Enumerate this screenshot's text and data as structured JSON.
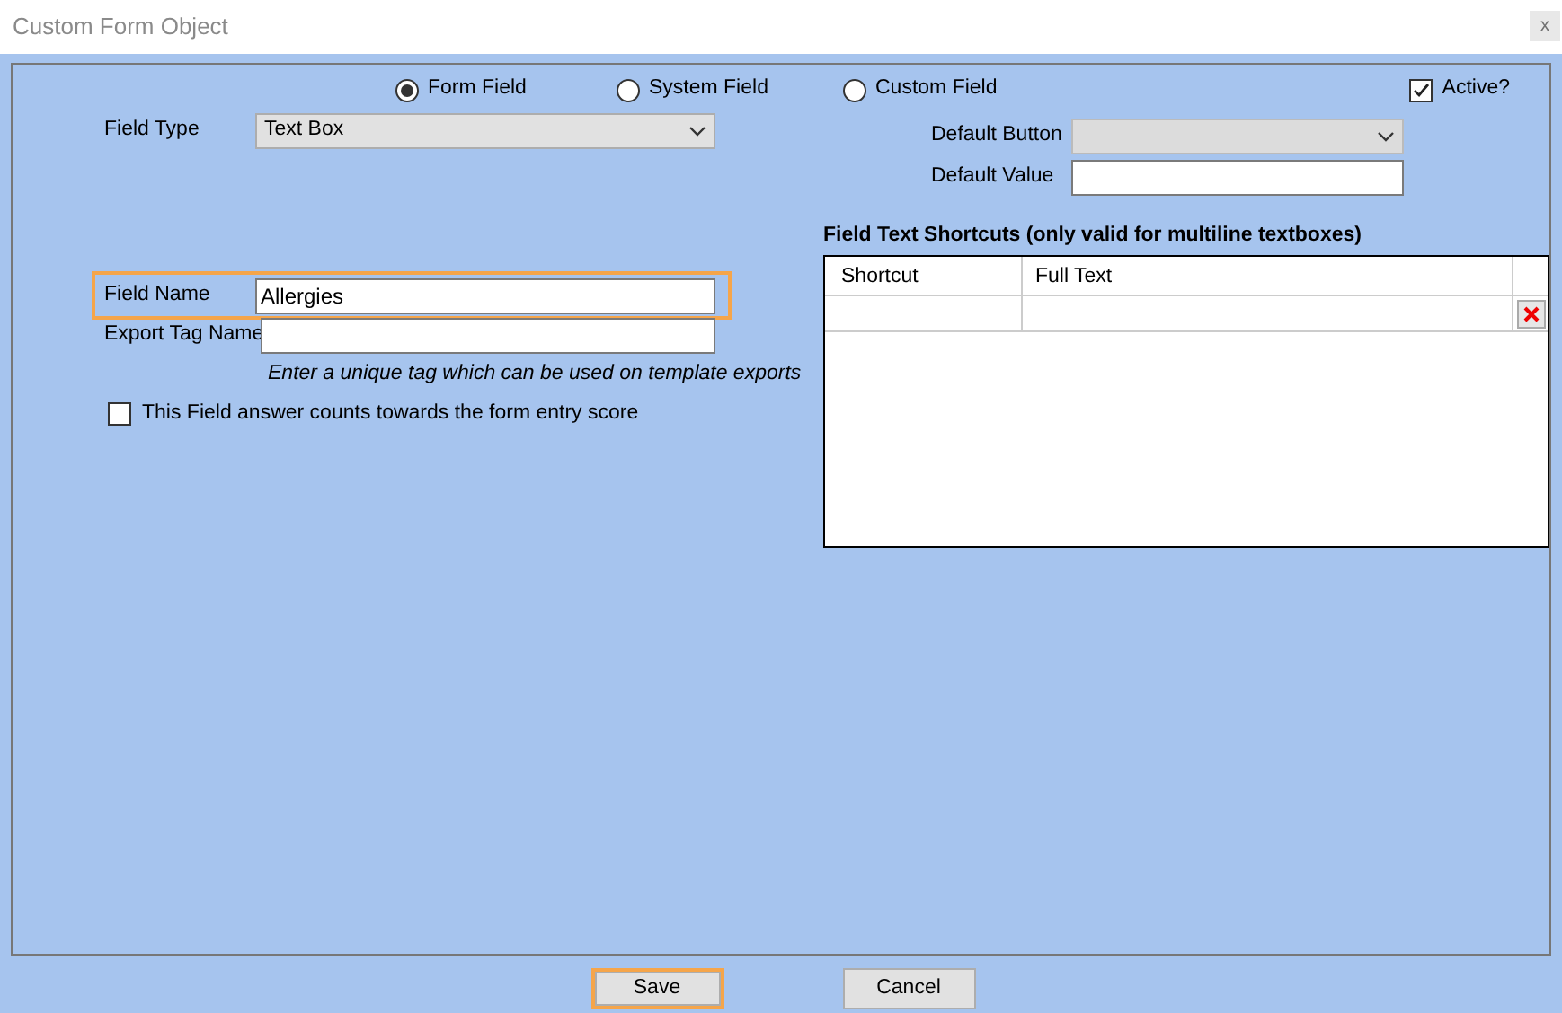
{
  "window": {
    "title": "Custom Form Object",
    "close_label": "x"
  },
  "field_source": [
    {
      "label": "Form Field",
      "selected": true
    },
    {
      "label": "System Field",
      "selected": false
    },
    {
      "label": "Custom Field",
      "selected": false
    }
  ],
  "active": {
    "label": "Active?",
    "checked": true
  },
  "field_type": {
    "label": "Field Type",
    "value": "Text Box"
  },
  "default_button": {
    "label": "Default Button",
    "disabled": true
  },
  "default_value": {
    "label": "Default Value"
  },
  "field_name": {
    "label": "Field Name",
    "value": "Allergies",
    "highlighted": true
  },
  "export_tag_name": {
    "label": "Export Tag Name",
    "hint": "Enter a unique tag which can be used on template exports"
  },
  "score_checkbox": {
    "label": "This Field answer counts towards the form entry score",
    "checked": false
  },
  "shortcuts": {
    "title": "Field Text Shortcuts (only valid for multiline textboxes)",
    "columns": [
      "Shortcut",
      "Full Text"
    ],
    "rows": [
      {
        "shortcut": "",
        "full_text": ""
      }
    ]
  },
  "buttons": [
    {
      "label": "Save",
      "focused": true
    },
    {
      "label": "Cancel",
      "focused": false
    }
  ]
}
